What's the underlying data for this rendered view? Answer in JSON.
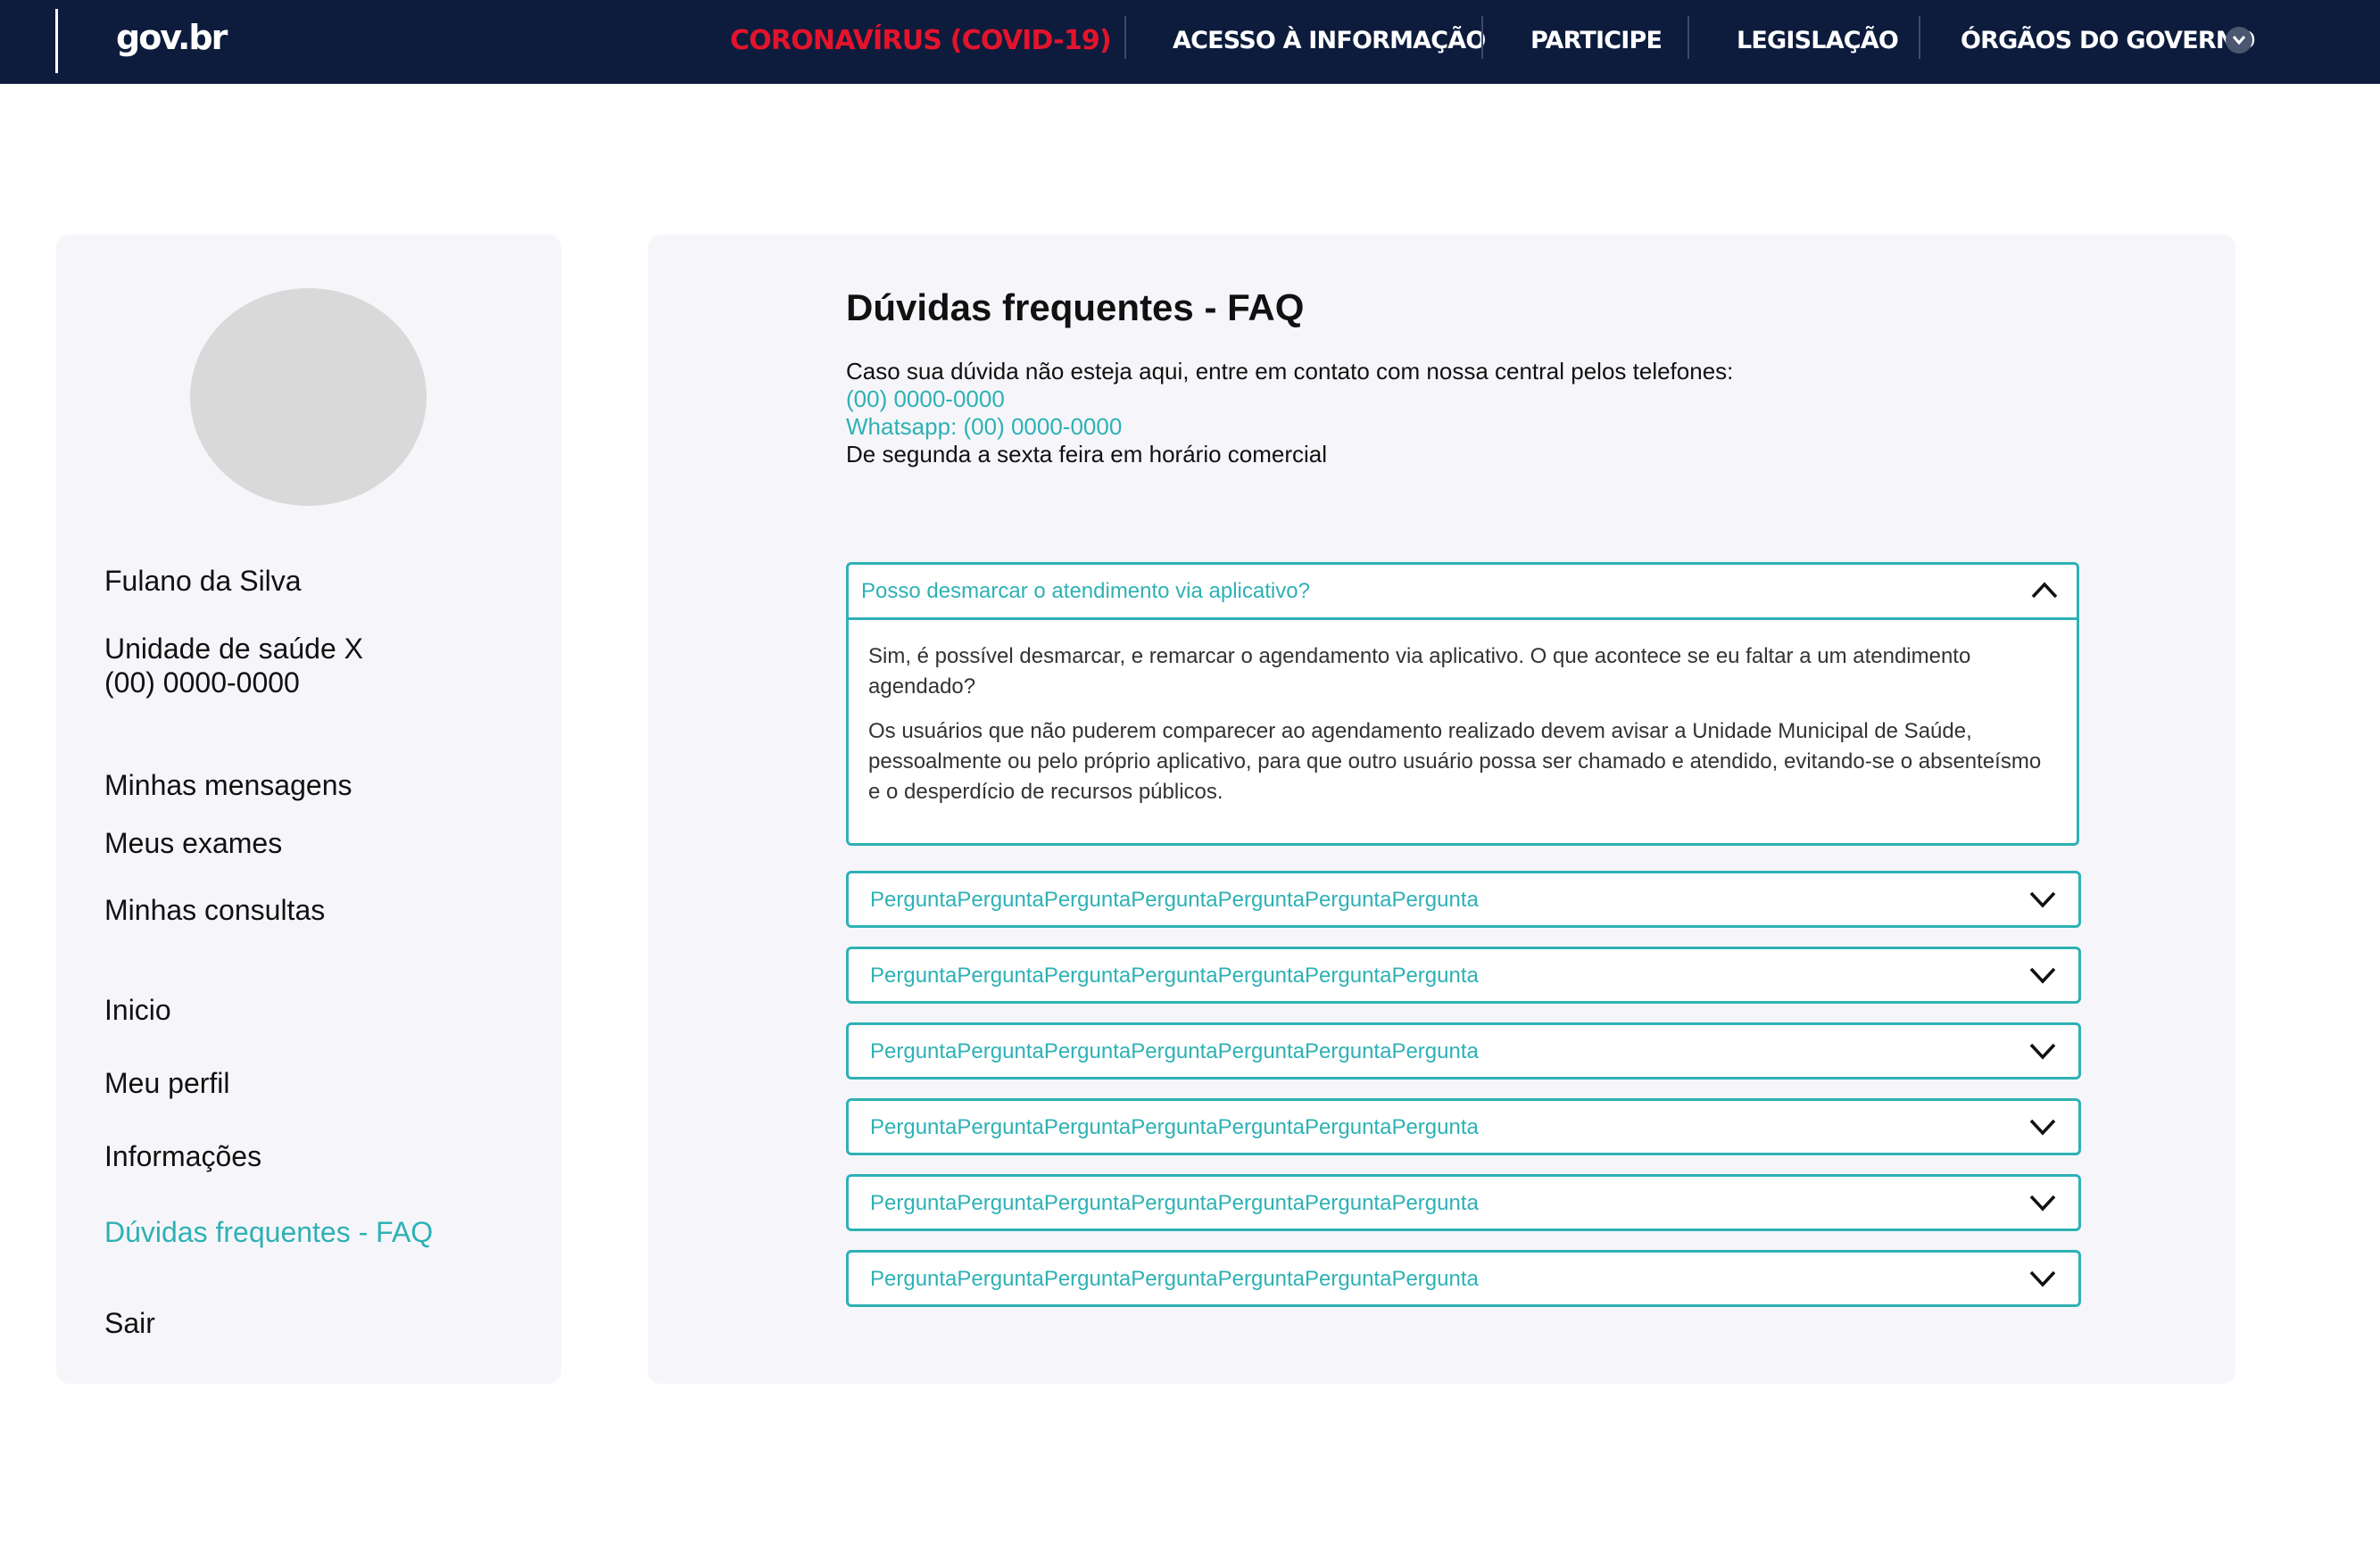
{
  "header": {
    "logo": "gov.br",
    "nav": [
      "CORONAVÍRUS (COVID-19)",
      "ACESSO À INFORMAÇÃO",
      "PARTICIPE",
      "LEGISLAÇÃO",
      "ÓRGÃOS DO GOVERNO"
    ],
    "colors": {
      "background": "#0d1c3d",
      "covid": "#e4132b"
    }
  },
  "sidebar": {
    "user_name": "Fulano da Silva",
    "unit": "Unidade de saúde X",
    "phone": "(00) 0000-0000",
    "items": [
      "Minhas mensagens",
      "Meus exames",
      "Minhas consultas",
      "Inicio",
      "Meu perfil",
      "Informações",
      "Dúvidas frequentes - FAQ",
      "Sair"
    ],
    "active_item": "Dúvidas frequentes - FAQ"
  },
  "main": {
    "title": "Dúvidas frequentes - FAQ",
    "intro": "Caso sua dúvida não esteja aqui, entre em contato com nossa central pelos telefones:",
    "phone": "(00) 0000-0000",
    "whatsapp": "Whatsapp: (00) 0000-0000",
    "hours": "De segunda a sexta feira em horário comercial",
    "faq_open": {
      "question": "Posso desmarcar o atendimento via aplicativo?",
      "answer_1": "Sim, é possível desmarcar, e remarcar o agendamento via aplicativo. O que acontece se eu faltar a um atendimento agendado?",
      "answer_2": "Os usuários que não puderem comparecer ao agendamento realizado devem avisar a Unidade Municipal de Saúde, pessoalmente ou pelo próprio aplicativo, para que outro usuário possa ser chamado e atendido, evitando-se o absenteísmo e o desperdício de recursos públicos."
    },
    "faq_items": [
      "PerguntaPerguntaPerguntaPerguntaPerguntaPerguntaPergunta",
      "PerguntaPerguntaPerguntaPerguntaPerguntaPerguntaPergunta",
      "PerguntaPerguntaPerguntaPerguntaPerguntaPerguntaPergunta",
      "PerguntaPerguntaPerguntaPerguntaPerguntaPerguntaPergunta",
      "PerguntaPerguntaPerguntaPerguntaPerguntaPerguntaPergunta",
      "PerguntaPerguntaPerguntaPerguntaPerguntaPerguntaPergunta"
    ],
    "accent_color": "#2eb1b5"
  }
}
